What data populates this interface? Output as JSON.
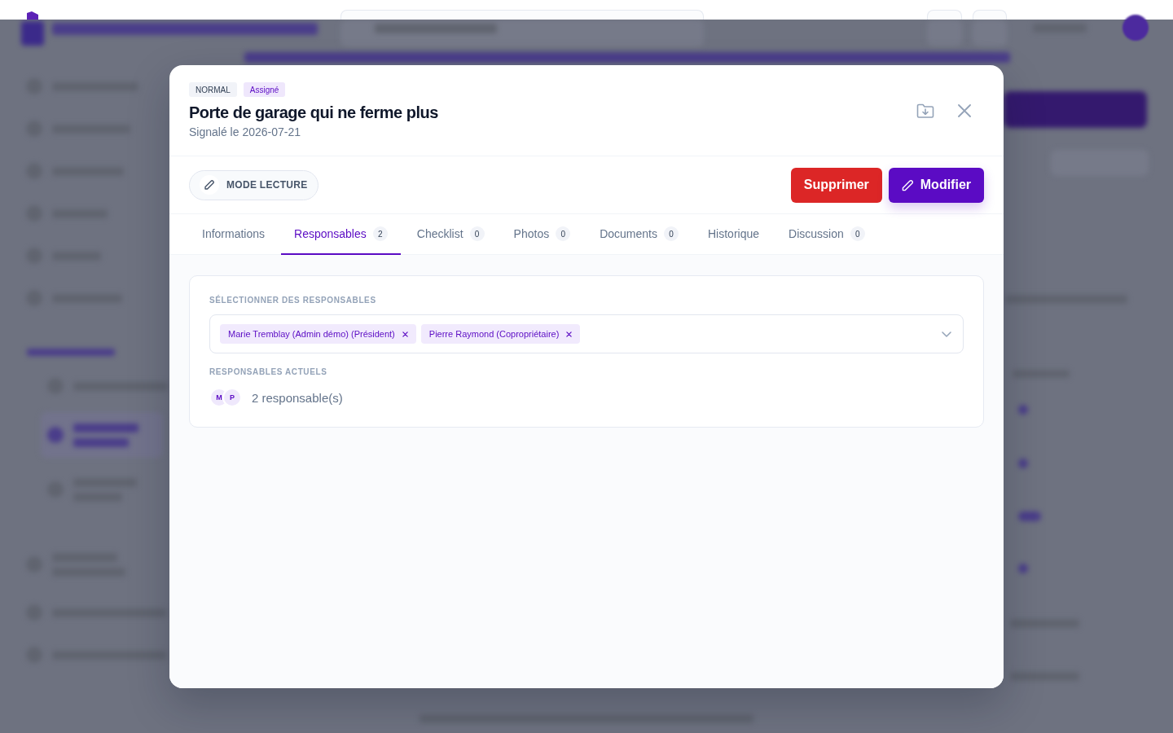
{
  "dialog": {
    "badges": [
      {
        "kind": "priority",
        "label": "NORMAL"
      },
      {
        "kind": "status",
        "label": "Assigné"
      }
    ],
    "title": "Porte de garage qui ne ferme plus",
    "subtitle": "Signalé le 2026-07-21"
  },
  "toolbar": {
    "mode_button": "MODE LECTURE",
    "delete_button": "Supprimer",
    "edit_button": "Modifier"
  },
  "tabs": [
    {
      "label": "Informations",
      "selected": false
    },
    {
      "label": "Responsables",
      "count": "2",
      "selected": true
    },
    {
      "label": "Checklist",
      "count": "0",
      "selected": false
    },
    {
      "label": "Photos",
      "count": "0",
      "selected": false
    },
    {
      "label": "Documents",
      "count": "0",
      "selected": false
    },
    {
      "label": "Historique",
      "selected": false
    },
    {
      "label": "Discussion",
      "count": "0",
      "selected": false
    }
  ],
  "responsables": {
    "select_label": "SÉLECTIONNER DES RESPONSABLES",
    "chips": [
      "Marie Tremblay (Admin démo) (Président)",
      "Pierre Raymond (Copropriétaire)"
    ],
    "current_label": "RESPONSABLES ACTUELS",
    "avatars": [
      "M",
      "P"
    ],
    "count_text": "2 responsable(s)"
  }
}
